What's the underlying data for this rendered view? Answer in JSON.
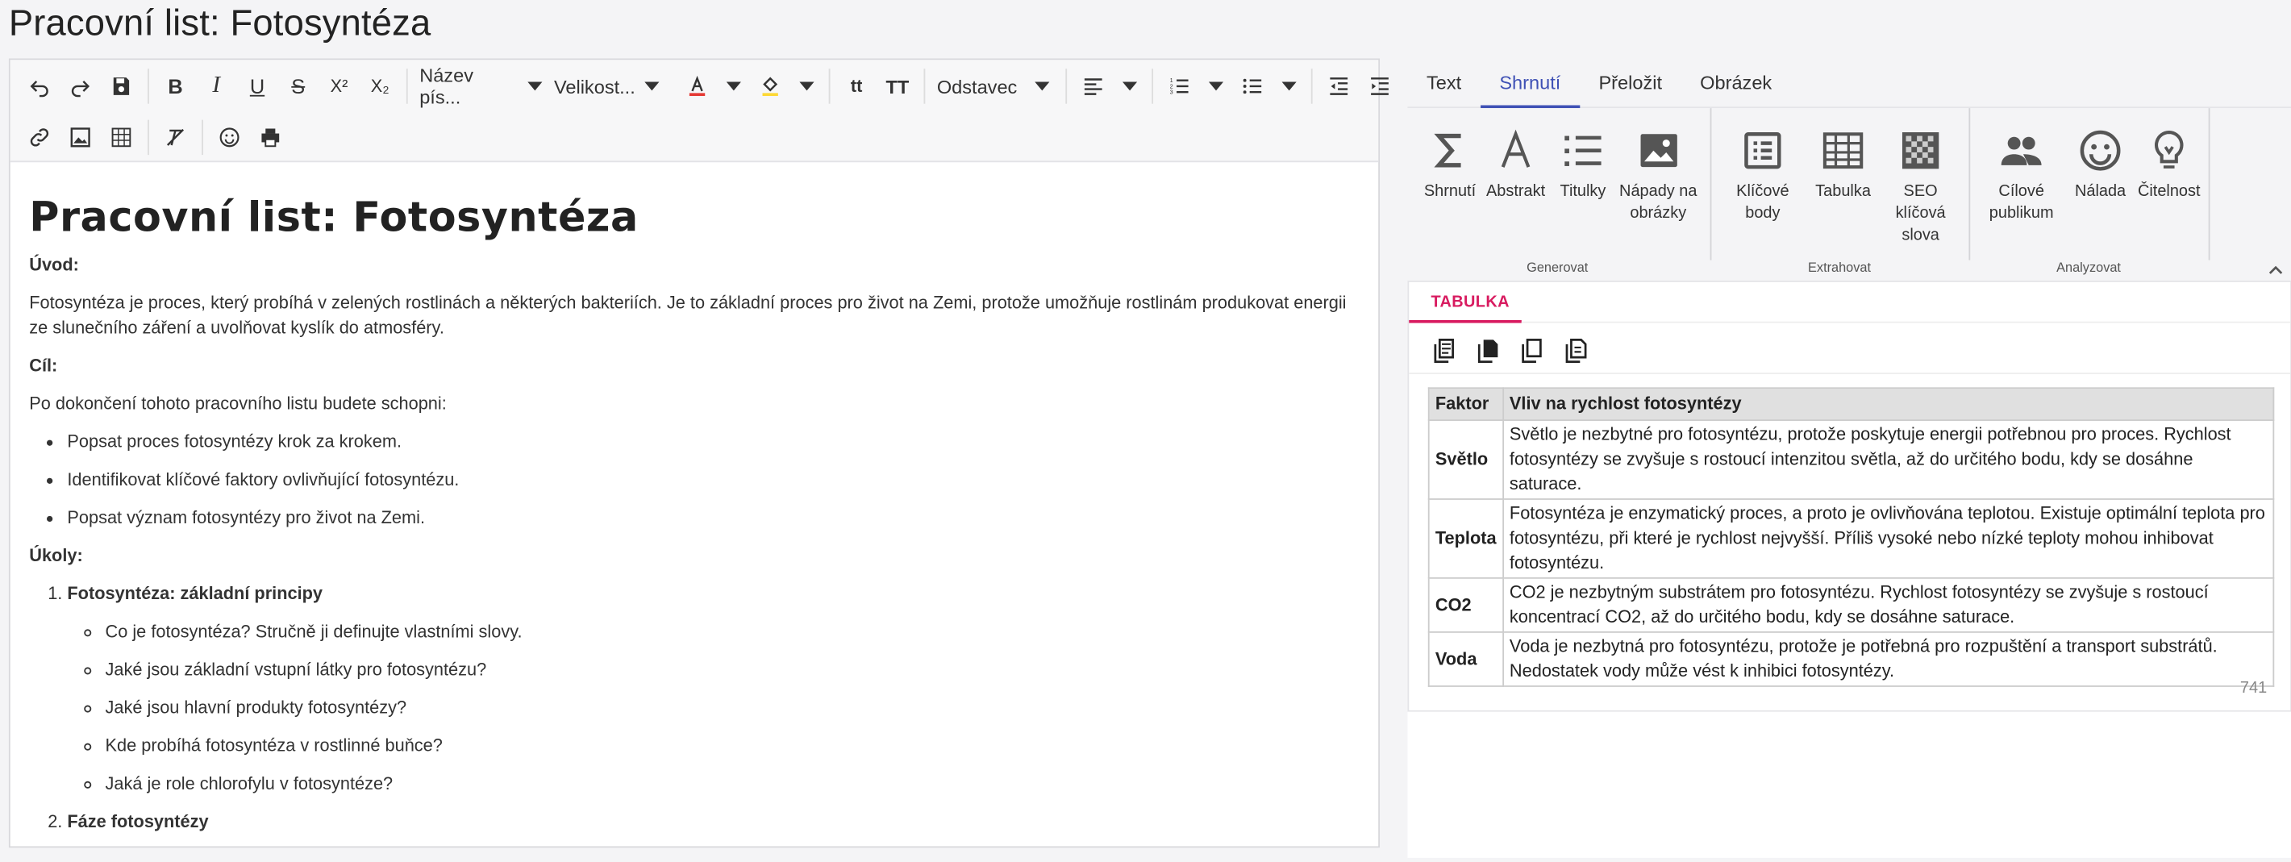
{
  "page_title": "Pracovní list: Fotosyntéza",
  "toolbar": {
    "font_name": "Název pís...",
    "font_size": "Velikost...",
    "paragraph": "Odstavec",
    "text_color": "#e53935",
    "highlight_color": "#fdd835"
  },
  "doc": {
    "heading": "Pracovní list: Fotosyntéza",
    "intro_label": "Úvod:",
    "intro_text": "Fotosyntéza je proces, který probíhá v zelených rostlinách a některých bakteriích. Je to základní proces pro život na Zemi, protože umožňuje rostlinám produkovat energii ze slunečního záření a uvolňovat kyslík do atmosféry.",
    "goal_label": "Cíl:",
    "goal_text": "Po dokončení tohoto pracovního listu budete schopni:",
    "goals": [
      "Popsat proces fotosyntézy krok za krokem.",
      "Identifikovat klíčové faktory ovlivňující fotosyntézu.",
      "Popsat význam fotosyntézy pro život na Zemi."
    ],
    "tasks_label": "Úkoly:",
    "tasks": [
      {
        "title": "Fotosyntéza: základní principy",
        "items": [
          "Co je fotosyntéza? Stručně ji definujte vlastními slovy.",
          "Jaké jsou základní vstupní látky pro fotosyntézu?",
          "Jaké jsou hlavní produkty fotosyntézy?",
          "Kde probíhá fotosyntéza v rostlinné buňce?",
          "Jaká je role chlorofylu v fotosyntéze?"
        ]
      },
      {
        "title": "Fáze fotosyntézy",
        "items": []
      }
    ]
  },
  "panel": {
    "tabs": [
      "Text",
      "Shrnutí",
      "Přeložit",
      "Obrázek"
    ],
    "groups": {
      "generate": "Generovat",
      "extract": "Extrahovat",
      "analyze": "Analyzovat"
    },
    "buttons": {
      "summary": "Shrnutí",
      "abstract": "Abstrakt",
      "titles": "Titulky",
      "image_ideas_1": "Nápady na",
      "image_ideas_2": "obrázky",
      "key_points_1": "Klíčové",
      "key_points_2": "body",
      "table": "Tabulka",
      "seo_1": "SEO",
      "seo_2": "klíčová",
      "seo_3": "slova",
      "audience_1": "Cílové",
      "audience_2": "publikum",
      "mood": "Nálada",
      "readability": "Čitelnost"
    },
    "section_tab": "TABULKA",
    "table": {
      "headers": [
        "Faktor",
        "Vliv na rychlost fotosyntézy"
      ],
      "rows": [
        [
          "Světlo",
          "Světlo je nezbytné pro fotosyntézu, protože poskytuje energii potřebnou pro proces. Rychlost fotosyntézy se zvyšuje s rostoucí intenzitou světla, až do určitého bodu, kdy se dosáhne saturace."
        ],
        [
          "Teplota",
          "Fotosyntéza je enzymatický proces, a proto je ovlivňována teplotou. Existuje optimální teplota pro fotosyntézu, při které je rychlost nejvyšší. Příliš vysoké nebo nízké teploty mohou inhibovat fotosyntézu."
        ],
        [
          "CO2",
          "CO2 je nezbytným substrátem pro fotosyntézu. Rychlost fotosyntézy se zvyšuje s rostoucí koncentrací CO2, až do určitého bodu, kdy se dosáhne saturace."
        ],
        [
          "Voda",
          "Voda je nezbytná pro fotosyntézu, protože je potřebná pro rozpuštění a transport substrátů. Nedostatek vody může vést k inhibici fotosyntézy."
        ]
      ]
    },
    "count": "741",
    "accent_color": "#3f51b5",
    "section_color": "#d81b60"
  }
}
